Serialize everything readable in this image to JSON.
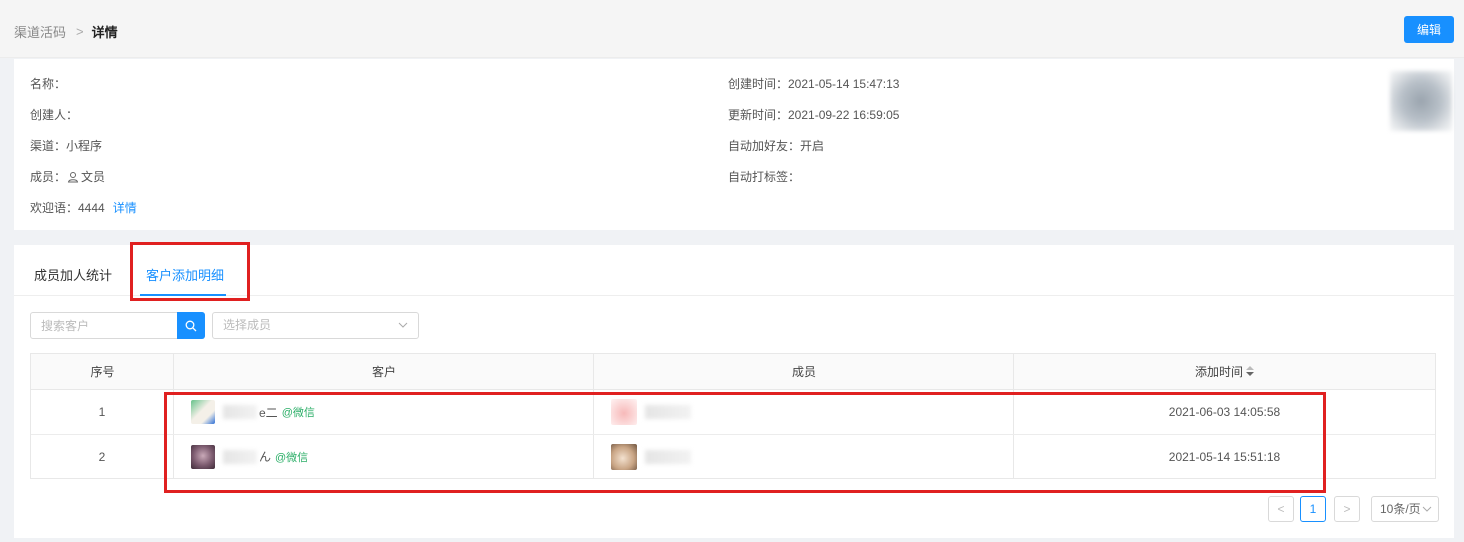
{
  "breadcrumb": {
    "parent": "渠道活码",
    "separator": ">",
    "current": "详情"
  },
  "header": {
    "edit_label": "编辑"
  },
  "info": {
    "name": "名称：",
    "creator": "创建人：",
    "channel": "渠道：小程序",
    "member_prefix": "成员：",
    "member_name": "文员",
    "welcome": "欢迎语：4444",
    "welcome_link": "详情",
    "created_at": "创建时间：2021-05-14 15:47:13",
    "updated_at": "更新时间：2021-09-22 16:59:05",
    "auto_friend": "自动加好友：开启",
    "auto_tag": "自动打标签："
  },
  "tabs": [
    {
      "label": "成员加人统计",
      "active": false
    },
    {
      "label": "客户添加明细",
      "active": true
    }
  ],
  "filters": {
    "search_placeholder": "搜索客户",
    "member_select_placeholder": "选择成员"
  },
  "table": {
    "columns": [
      "序号",
      "客户",
      "成员",
      "添加时间"
    ],
    "sort_icon": "sort-caret-icon",
    "rows": [
      {
        "index": "1",
        "customer_suffix": "e二",
        "customer_source": "@微信",
        "time": "2021-06-03 14:05:58"
      },
      {
        "index": "2",
        "customer_suffix": "ん",
        "customer_source": "@微信",
        "time": "2021-05-14 15:51:18"
      }
    ]
  },
  "pagination": {
    "prev": "<",
    "current_page": "1",
    "next": ">",
    "page_size": "10条/页"
  },
  "colors": {
    "accent": "#1890ff",
    "highlight_box": "#e02020",
    "wechat": "#2bae67"
  }
}
